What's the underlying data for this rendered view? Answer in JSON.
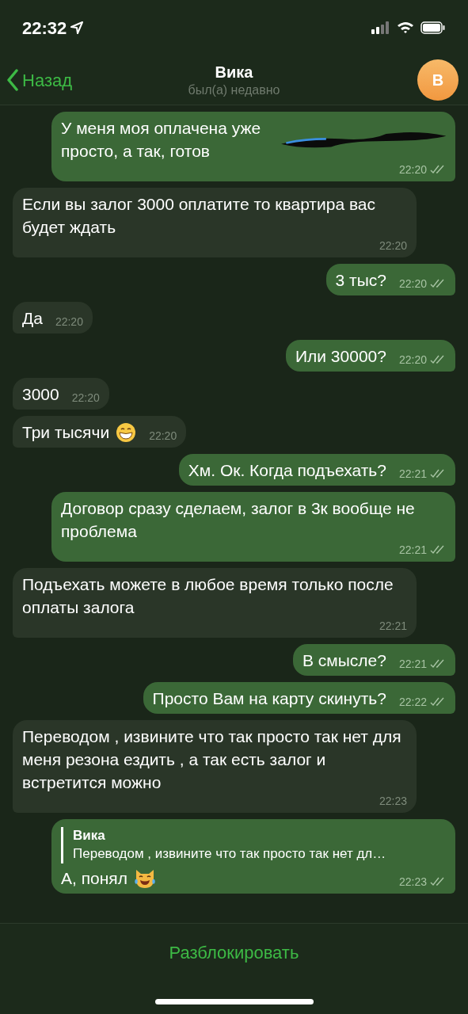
{
  "status_bar": {
    "time": "22:32"
  },
  "header": {
    "back": "Назад",
    "title": "Вика",
    "subtitle": "был(а) недавно",
    "avatar": "В"
  },
  "messages": [
    {
      "outgoing": true,
      "redacted": true,
      "text": "У меня моя оплачена уже просто, а так, готов",
      "time": "22:20"
    },
    {
      "outgoing": false,
      "text": "Если вы залог 3000 оплатите то квартира вас будет ждать",
      "time": "22:20"
    },
    {
      "outgoing": true,
      "text": "3 тыс?",
      "time": "22:20"
    },
    {
      "outgoing": false,
      "text": "Да",
      "time": "22:20"
    },
    {
      "outgoing": true,
      "text": "Или 30000?",
      "time": "22:20"
    },
    {
      "outgoing": false,
      "text": "3000",
      "time": "22:20"
    },
    {
      "outgoing": false,
      "kind": "grin",
      "text": "Три тысячи",
      "time": "22:20"
    },
    {
      "outgoing": true,
      "text": "Хм. Ок. Когда подъехать?",
      "time": "22:21"
    },
    {
      "outgoing": true,
      "text": "Договор сразу сделаем, залог в 3к вообще не проблема",
      "time": "22:21"
    },
    {
      "outgoing": false,
      "text": "Подъехать можете в любое время только после оплаты залога",
      "time": "22:21"
    },
    {
      "outgoing": true,
      "text": "В смысле?",
      "time": "22:21"
    },
    {
      "outgoing": true,
      "text": "Просто Вам на карту скинуть?",
      "time": "22:22"
    },
    {
      "outgoing": false,
      "text": "Переводом , извините что так просто так нет для меня резона ездить , а так есть залог и встретится можно",
      "time": "22:23"
    },
    {
      "outgoing": true,
      "reply": {
        "name": "Вика",
        "text": "Переводом , извините что так просто так нет дл…"
      },
      "kind": "cat",
      "text": "А, понял",
      "time": "22:23"
    }
  ],
  "footer": {
    "action": "Разблокировать"
  }
}
